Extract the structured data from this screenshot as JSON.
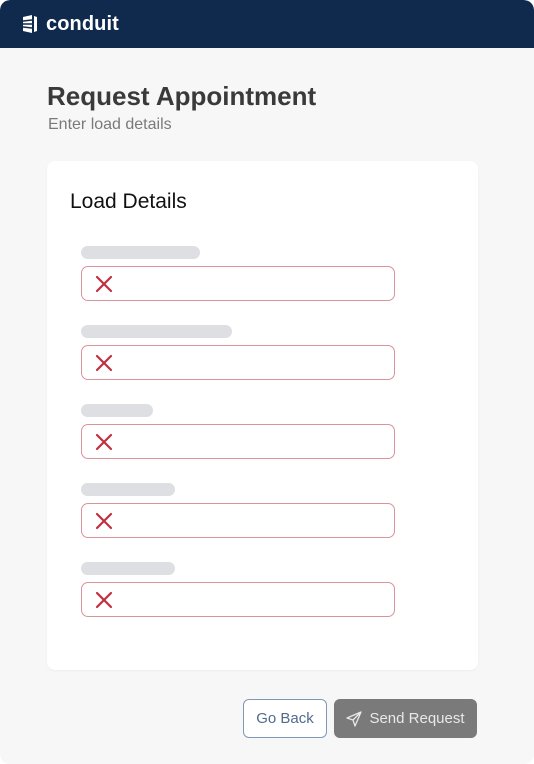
{
  "app": {
    "brand_name": "conduit"
  },
  "page": {
    "title": "Request Appointment",
    "subtitle": "Enter load details"
  },
  "card": {
    "title": "Load Details",
    "fields": [
      {
        "label_placeholder": "loading",
        "value": "",
        "status": "invalid"
      },
      {
        "label_placeholder": "loading",
        "value": "",
        "status": "invalid"
      },
      {
        "label_placeholder": "loading",
        "value": "",
        "status": "invalid"
      },
      {
        "label_placeholder": "loading",
        "value": "",
        "status": "invalid"
      },
      {
        "label_placeholder": "loading",
        "value": "",
        "status": "invalid"
      }
    ]
  },
  "actions": {
    "back_label": "Go Back",
    "send_label": "Send Request"
  },
  "icons": {
    "brand": "conduit-logo-icon",
    "field_status": "x-icon",
    "send": "paper-plane-icon"
  },
  "colors": {
    "topbar": "#0f2a4d",
    "error": "#c0303e",
    "error_border": "#d9939a",
    "skeleton": "#dedfe2",
    "send_button_disabled": "#7a7a7a",
    "back_button_border": "#7f99b5"
  }
}
